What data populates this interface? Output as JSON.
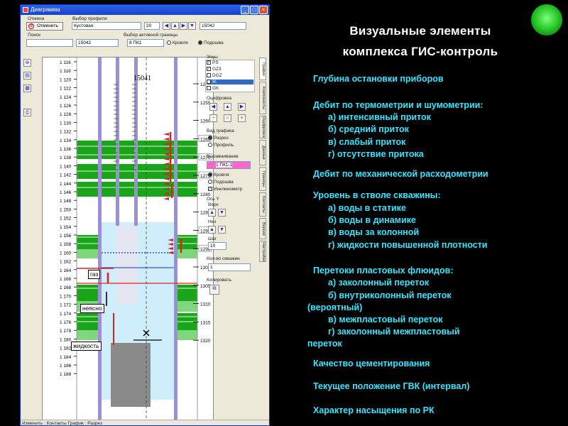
{
  "window": {
    "title": "Диаграмма"
  },
  "toolbar": {
    "cancel_group_label": "Отмена",
    "cancel_button": "Отменить",
    "profile_group_label": "Выбор профиля",
    "profile_value": "Кустовая",
    "profile_num": "20",
    "profile_well": "15042",
    "search_label": "Поиск",
    "search_well": "15042",
    "boundary_label": "Выбор активной границы",
    "boundary_value": "8 ПК1",
    "boundary_roof": "Кровля",
    "boundary_floor": "Подошва"
  },
  "plot": {
    "well_number": "15041",
    "tag_gas": "газ",
    "tag_unclear": "неясно",
    "tag_liquid": "жидкость"
  },
  "side_tabs": [
    "График",
    "Компоненты",
    "Оцифровка",
    "Данные",
    "Границы",
    "Контакты",
    "Версии",
    "Настройки"
  ],
  "panel": {
    "zones_title": "Зоны",
    "zones": [
      "PS",
      "GZ3",
      "DGZ",
      "IK",
      "GK"
    ],
    "digitize_title": "Оцифровка",
    "view_title": "Вид графика",
    "view_options": [
      "Разрез",
      "Профиль"
    ],
    "align_title": "Выравнивание",
    "align_value": "1 ПК1-1",
    "align_options": [
      "Кровля",
      "Подошва",
      "Инклинометр"
    ],
    "yaxis_title": "Ось Y",
    "yaxis_top": "Верх",
    "yaxis_bottom": "Низ",
    "yaxis_step": "Шаг",
    "yaxis_step_value": "10",
    "wells_count_title": "Кол-во скважин",
    "wells_count_value": "1",
    "copy_title": "Копировать"
  },
  "status_bar": "Изменить : Контакты     График : Разрез",
  "slide": {
    "title_line1": "Визуальные элементы",
    "title_line2": "комплекса ГИС-контроль",
    "bullets": [
      "Глубина остановки приборов",
      "Дебит по термометрии и шумометрии:",
      "а) интенсивный приток",
      "б) средний приток",
      "в) слабый приток",
      "г) отсутствие притока",
      "Дебит по механической расходометрии",
      "Уровень в стволе скважины:",
      "а) воды в статике",
      "б) воды в динамике",
      "в) воды за колонной",
      "г) жидкости повышенной плотности",
      "Перетоки пластовых флюидов:",
      "а) заколонный переток",
      "б) внутриколонный переток",
      "(вероятный)",
      "в) межпластовый переток",
      "г) заколонный межпластовый",
      "переток",
      "Качество цементирования",
      "Текущее положение ГВК (интервал)",
      "Характер насыщения по РК"
    ]
  },
  "depth": {
    "left_ticks": [
      "1 116",
      "1 118",
      "1 120",
      "1 122",
      "1 124",
      "1 126",
      "1 128",
      "1 130",
      "1 132",
      "1 134",
      "1 136",
      "1 138",
      "1 140",
      "1 142",
      "1 144",
      "1 146",
      "1 148",
      "1 150",
      "1 152",
      "1 154",
      "1 156",
      "1 158",
      "1 160",
      "1 162",
      "1 164",
      "1 166",
      "1 168",
      "1 170",
      "1 172",
      "1 174",
      "1 176",
      "1 178",
      "1 180",
      "1 182",
      "1 184",
      "1 186",
      "1 188"
    ],
    "right_ticks": [
      "1250",
      "1255",
      "1260",
      "1265",
      "1270",
      "1275",
      "1280",
      "1285",
      "1290",
      "1295",
      "1300",
      "1305",
      "1310",
      "1315",
      "1320"
    ],
    "highlighted_right": [
      "1265",
      "1270",
      "1275",
      "1290",
      "1295"
    ]
  },
  "colors": {
    "slide_text": "#35e6ff",
    "green_band": "#1aa51a",
    "light_green": "#7fd67f",
    "water": "#cdeefa",
    "casing": "#9b8fd6",
    "red": "#e02020"
  }
}
